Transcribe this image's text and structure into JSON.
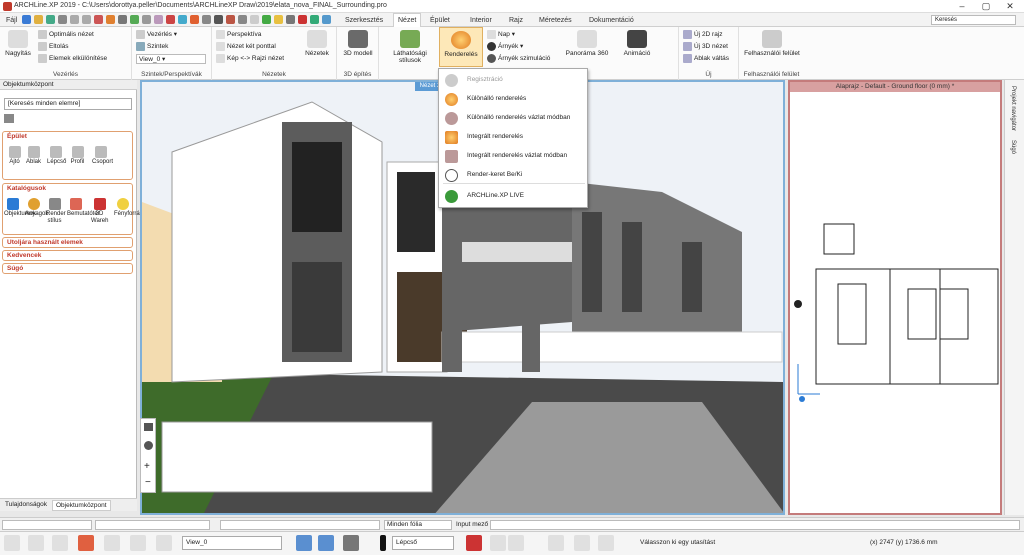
{
  "titlebar": {
    "title": "ARCHLine.XP 2019 - C:\\Users\\dorottya.peller\\Documents\\ARCHLineXP Draw\\2019\\elata_nova_FINAL_Surrounding.pro",
    "minimize": "–",
    "maximize": "▢",
    "close": "✕"
  },
  "tabs": [
    {
      "label": "Fájl"
    },
    {
      "label": "Szerkesztés"
    },
    {
      "label": "Nézet"
    },
    {
      "label": "Épület"
    },
    {
      "label": "Interior"
    },
    {
      "label": "Rajz"
    },
    {
      "label": "Méretezés"
    },
    {
      "label": "Dokumentáció"
    }
  ],
  "search": {
    "placeholder": "Keresés"
  },
  "ribbon": {
    "nagyitas": "Nagyítás",
    "optimalis": "Optimális nézet",
    "eltolas": "Eltolás",
    "elemek_elkul": "Elemek elkülönítése",
    "vezerles_group": "Vezérlés",
    "vezerles": "Vezérlés",
    "szintek": "Szintek",
    "view0": "View_0",
    "szintek_group": "Szintek/Perspektívák",
    "perspektiva": "Perspektíva",
    "nezet_ket_pontal": "Nézet két ponttal",
    "kep_rajzi": "Kép <-> Rajzi nézet",
    "nezetek": "Nézetek",
    "nezetek_group": "Nézetek",
    "modell3d": "3D modell",
    "epites3d_group": "3D építés",
    "lathatosagi": "Láthatósági stílusok",
    "rendereles": "Renderelés",
    "nap": "Nap",
    "arnyek": "Árnyék",
    "arnyek_szim": "Árnyék szimuláció",
    "panorama": "Panoráma 360",
    "animacio": "Animáció",
    "uj2d": "Új 2D rajz",
    "uj3d": "Új 3D nézet",
    "ablakvaltas": "Ablak váltás",
    "uj_group": "Új",
    "felhasznaloi": "Felhasználói felület",
    "felhasznaloi_group": "Felhasználói felület"
  },
  "render_menu": [
    {
      "label": "Regisztráció",
      "icon": "register-icon",
      "disabled": true
    },
    {
      "label": "Különálló renderelés",
      "icon": "render-sphere-icon"
    },
    {
      "label": "Különálló renderelés vázlat módban",
      "icon": "render-sketch-icon"
    },
    {
      "label": "Integrált renderelés",
      "icon": "integrated-render-icon"
    },
    {
      "label": "Integrált renderelés vázlat módban",
      "icon": "integrated-sketch-icon"
    },
    {
      "label": "Render-keret Be/Ki",
      "icon": "render-frame-icon"
    },
    {
      "label": "ARCHLine.XP LIVE",
      "icon": "live-icon"
    }
  ],
  "left_panel": {
    "title": "Objektumközpont",
    "search_placeholder": "[Keresés minden elemre]",
    "epulet": "Épület",
    "epulet_items": [
      {
        "label": "Ajtó"
      },
      {
        "label": "Ablak"
      },
      {
        "label": "Lépcső"
      },
      {
        "label": "Profil"
      },
      {
        "label": "Csoport"
      }
    ],
    "katalogusok": "Katalógusok",
    "katalogus_items": [
      {
        "label": "Objektumok"
      },
      {
        "label": "Anyagok"
      },
      {
        "label": "Render stílus"
      },
      {
        "label": "Bemutatótér"
      },
      {
        "label": "3D Wareh"
      },
      {
        "label": "Fényforrás"
      }
    ],
    "utoljara": "Utoljára használt elemek",
    "kedvencek": "Kedvencek",
    "sugo": "Súgó",
    "tab1": "Tulajdonságok",
    "tab2": "Objektumközpont"
  },
  "viewport": {
    "tag": "Nézet 2"
  },
  "plan": {
    "title": "Alaprajz - Default - Ground floor (0 mm) *"
  },
  "right_rail": {
    "tab1": "Projekt navigátor",
    "tab2": "Súgó"
  },
  "statusbar": {
    "layer": "Minden fólia",
    "input_label": "Input mező",
    "view_select": "View_0",
    "lepcso": "Lépcső",
    "prompt": "Válasszon ki egy utasítást",
    "coords": "(x) 2747  (y) 1736.6 mm"
  },
  "colors": {
    "accent": "#c0392b",
    "view_border": "#7fb0d8",
    "plan_border": "#c47b7b"
  }
}
